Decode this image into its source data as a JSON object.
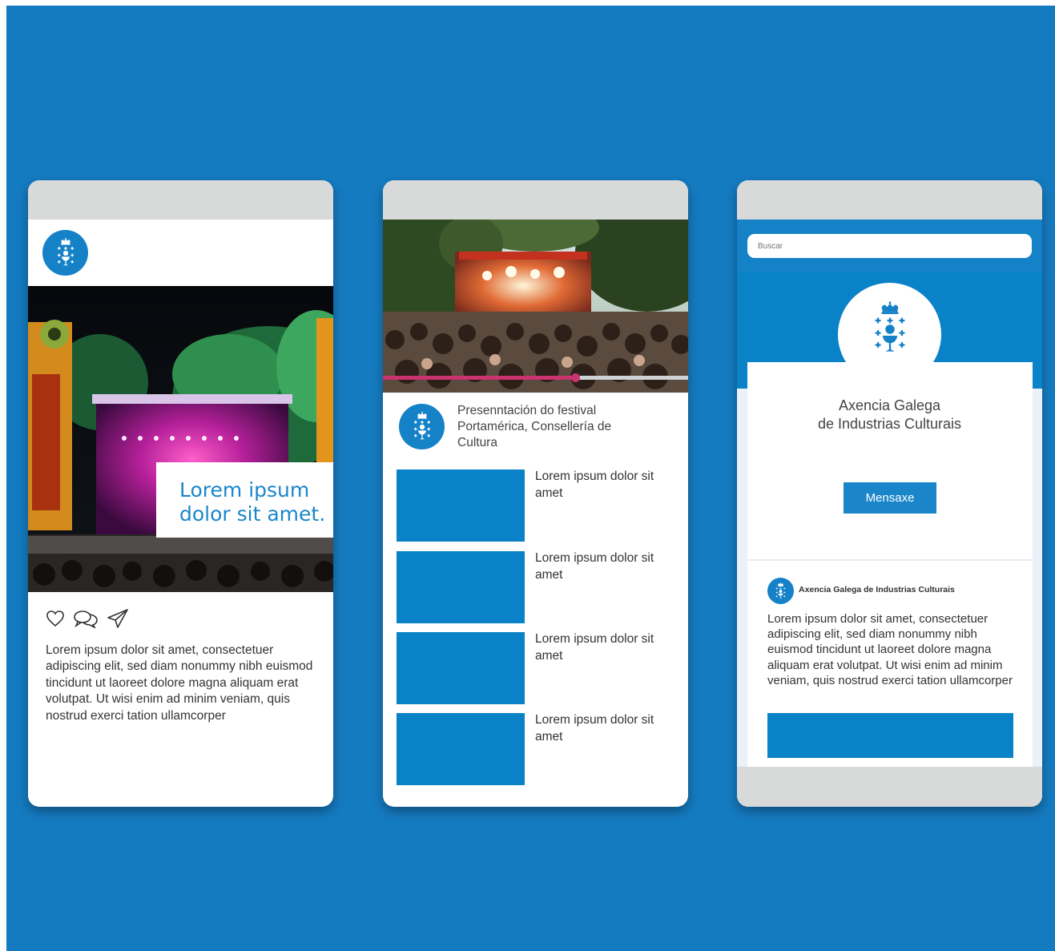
{
  "colors": {
    "background": "#157bc1",
    "brand_blue": "#1581c7",
    "placeholder_blue": "#0a82c8",
    "progress": "#c9336f",
    "frame_gray": "#d8d9d9"
  },
  "phone1": {
    "caption": "Lorem ipsum\ndolor sit amet.",
    "icons": [
      "heart-icon",
      "comment-icon",
      "send-icon"
    ],
    "body_text": "Lorem ipsum dolor sit amet, consectetuer adipiscing elit, sed diam nonummy nibh euismod tincidunt ut laoreet dolore magna aliquam erat volutpat. Ut wisi enim ad minim veniam, quis nostrud exerci tation ullamcorper"
  },
  "phone2": {
    "video_progress": 0.63,
    "title": "Presenntación do festival Portamérica, Consellería de Cultura",
    "items": [
      {
        "label": "Lorem ipsum dolor sit amet"
      },
      {
        "label": "Lorem ipsum dolor sit amet"
      },
      {
        "label": "Lorem ipsum dolor sit amet"
      },
      {
        "label": "Lorem ipsum dolor sit amet"
      }
    ]
  },
  "phone3": {
    "search_placeholder": "Buscar",
    "profile_name": "Axencia Galega\nde Industrias Culturais",
    "message_button": "Mensaxe",
    "post_author": "Axencia Galega de Industrias Culturais",
    "post_text": "Lorem ipsum dolor sit amet, consectetuer adipiscing elit, sed diam nonummy nibh euismod tincidunt ut laoreet dolore magna aliquam erat volutpat. Ut wisi enim ad minim veniam, quis nostrud exerci tation ullamcorper"
  }
}
